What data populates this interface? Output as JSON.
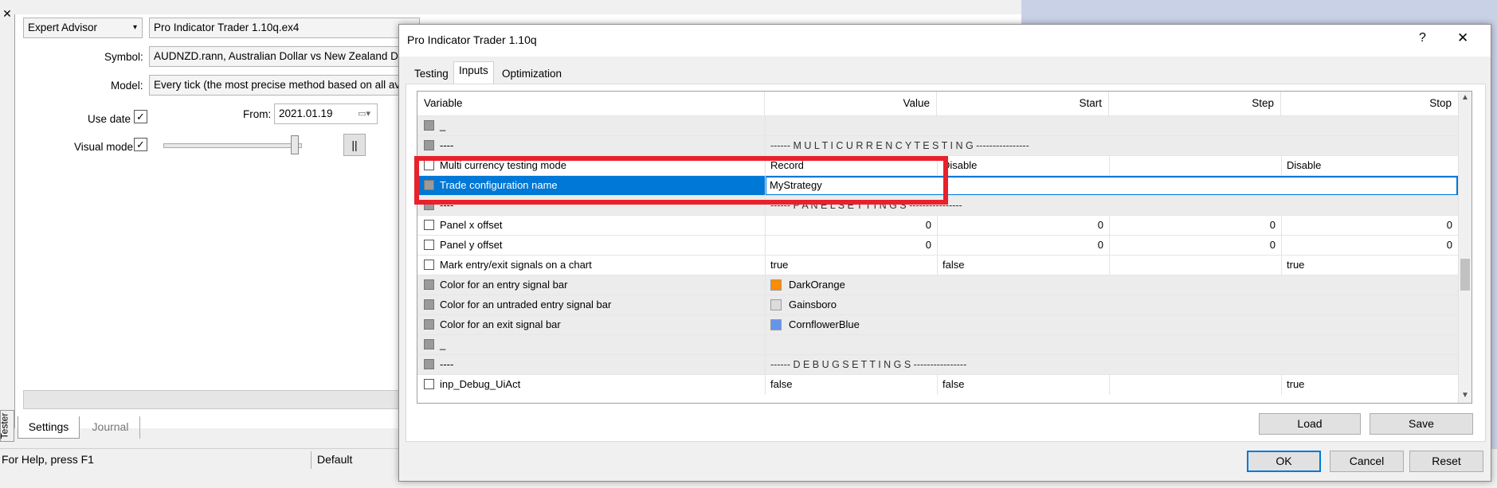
{
  "tester": {
    "close_glyph": "✕",
    "type_value": "Expert Advisor",
    "ea_value": "Pro Indicator Trader 1.10q.ex4",
    "symbol_label": "Symbol:",
    "symbol_value": "AUDNZD.rann, Australian Dollar vs New Zealand Dollar",
    "model_label": "Model:",
    "model_value": "Every tick (the most precise method based on all available least timeframes)",
    "use_date_label": "Use date",
    "use_date_checked": "✓",
    "from_label": "From:",
    "from_value": "2021.01.19",
    "visual_mode_label": "Visual mode",
    "visual_mode_checked": "✓",
    "pause_label": "||",
    "side_tab": "Tester",
    "bottom_tabs": [
      "Settings",
      "Journal"
    ]
  },
  "statusbar": {
    "help_text": "For Help, press F1",
    "profile_text": "Default"
  },
  "dialog": {
    "title": "Pro Indicator Trader 1.10q",
    "help_glyph": "?",
    "close_glyph": "✕",
    "tabs": [
      "Testing",
      "Inputs",
      "Optimization"
    ],
    "active_tab": "Inputs",
    "columns": [
      "Variable",
      "Value",
      "Start",
      "Step",
      "Stop"
    ],
    "rows": [
      {
        "name": "_",
        "value": "",
        "start": "",
        "step": "",
        "stop": "",
        "type": "sep"
      },
      {
        "name": "----",
        "value": "------ M U L T I C U R R E N C Y   T E S T I N G ----------------",
        "start": "",
        "step": "",
        "stop": "",
        "type": "sep"
      },
      {
        "name": "Multi currency testing mode",
        "value": "Record",
        "start": "Disable",
        "step": "",
        "stop": "Disable",
        "type": "normal"
      },
      {
        "name": "Trade configuration name",
        "value": "MyStrategy",
        "start": "",
        "step": "",
        "stop": "",
        "type": "selected"
      },
      {
        "name": "----",
        "value": "------ P A N E L   S E T T I N G S ----------------",
        "start": "",
        "step": "",
        "stop": "",
        "type": "sep"
      },
      {
        "name": "Panel x offset",
        "value": "0",
        "start": "0",
        "step": "0",
        "stop": "0",
        "type": "numeric"
      },
      {
        "name": "Panel y offset",
        "value": "0",
        "start": "0",
        "step": "0",
        "stop": "0",
        "type": "numeric"
      },
      {
        "name": "Mark entry/exit signals on a chart",
        "value": "true",
        "start": "false",
        "step": "",
        "stop": "true",
        "type": "normal"
      },
      {
        "name": "Color for an entry signal bar",
        "value": "DarkOrange",
        "swatch": "#ff8c00",
        "start": "",
        "step": "",
        "stop": "",
        "type": "color"
      },
      {
        "name": "Color for an untraded entry signal bar",
        "value": "Gainsboro",
        "swatch": "#dcdcdc",
        "start": "",
        "step": "",
        "stop": "",
        "type": "color"
      },
      {
        "name": "Color for an exit signal bar",
        "value": "CornflowerBlue",
        "swatch": "#6495ed",
        "start": "",
        "step": "",
        "stop": "",
        "type": "color"
      },
      {
        "name": "_",
        "value": "",
        "start": "",
        "step": "",
        "stop": "",
        "type": "sep"
      },
      {
        "name": "----",
        "value": "------ D E B U G   S E T T I N G S ----------------",
        "start": "",
        "step": "",
        "stop": "",
        "type": "sep"
      },
      {
        "name": "inp_Debug_UiAct",
        "value": "false",
        "start": "false",
        "step": "",
        "stop": "true",
        "type": "normal"
      }
    ],
    "load_label": "Load",
    "save_label": "Save",
    "ok_label": "OK",
    "cancel_label": "Cancel",
    "reset_label": "Reset"
  },
  "colors": {
    "selection": "#0078d7",
    "highlight_box": "#e8212b"
  }
}
